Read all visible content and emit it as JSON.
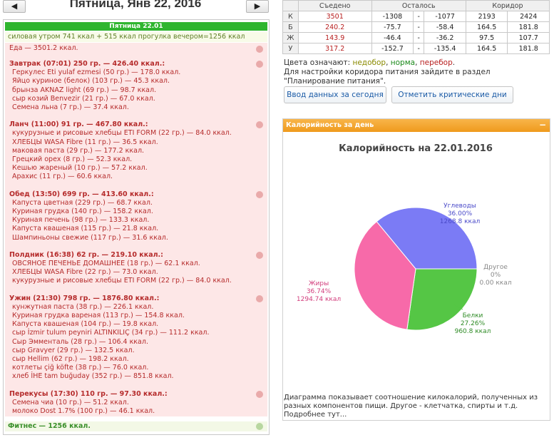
{
  "nav": {
    "prev_symbol": "◀",
    "next_symbol": "▶",
    "date_title": "Пятница, Янв 22, 2016"
  },
  "diary": {
    "day_bar": "Пятница 22.01",
    "activity": "силовая утром 741 ккал + 515 ккал прогулка вечером=1256 ккал",
    "food_total": "Еда — 3501.2 ккал.",
    "meals": [
      {
        "header": "Завтрак (07:01) 250 гр. — 426.40 ккал.:",
        "items": [
          "Геркулес Eti yulaf ezmesi (50 гр.) — 178.0 ккал.",
          "Яйцо куриное (белок) (103 гр.) — 45.3 ккал.",
          "брынза AKNAZ light (69 гр.) — 98.7 ккал.",
          "сыр козий Benvezir (21 гр.) — 67.0 ккал.",
          "Семена льна (7 гр.) — 37.4 ккал."
        ]
      },
      {
        "header": "Ланч (11:00) 91 гр. — 467.80 ккал.:",
        "items": [
          "кукурузные и рисовые хлебцы ETI FORM (22 гр.) — 84.0 ккал.",
          "ХЛЕБЦЫ WASA Fibre (11 гр.) — 36.5 ккал.",
          "маковая паста (29 гр.) — 177.2 ккал.",
          "Грецкий орех (8 гр.) — 52.3 ккал.",
          "Кешью жареный (10 гр.) — 57.2 ккал.",
          "Арахис (11 гр.) — 60.6 ккал."
        ]
      },
      {
        "header": "Обед (13:50) 699 гр. — 413.60 ккал.:",
        "items": [
          "Капуста цветная (229 гр.) — 68.7 ккал.",
          "Куриная грудка (140 гр.) — 158.2 ккал.",
          "Куриная печень (98 гр.) — 133.3 ккал.",
          "Капуста квашеная (115 гр.) — 21.8 ккал.",
          "Шампиньоны свежие (117 гр.) — 31.6 ккал."
        ]
      },
      {
        "header": "Полдник (16:38) 62 гр. — 219.10 ккал.:",
        "items": [
          "ОВСЯНОЕ ПЕЧЕНЬЕ ДОМАШНЕЕ (18 гр.) — 62.1 ккал.",
          "ХЛЕБЦЫ WASA Fibre (22 гр.) — 73.0 ккал.",
          "кукурузные и рисовые хлебцы ETI FORM (22 гр.) — 84.0 ккал."
        ]
      },
      {
        "header": "Ужин (21:30) 798 гр. — 1876.80 ккал.:",
        "items": [
          "кунжутная паста (38 гр.) — 226.1 ккал.",
          "Куриная грудка вареная (113 гр.) — 154.8 ккал.",
          "Капуста квашеная (104 гр.) — 19.8 ккал.",
          "сыр İzmir tulum peyniri ALTINKILIÇ (34 гр.) — 111.2 ккал.",
          "Сыр Эмменталь (28 гр.) — 106.4 ккал.",
          "сыр Gravyer (29 гр.) — 132.5 ккал.",
          "сыр Hellim (62 гр.) — 198.2 ккал.",
          "котлеты çiğ köfte (38 гр.) — 76.0 ккал.",
          "хлеб İHE tam buğuday (352 гр.) — 851.8 ккал."
        ]
      },
      {
        "header": "Перекусы (17:30) 110 гр. — 97.30 ккал.:",
        "items": [
          "Семена чиа (10 гр.) — 51.2 ккал.",
          "молоко Dost 1.7% (100 гр.) — 46.1 ккал."
        ]
      }
    ],
    "fitness": "Фитнес — 1256 ккал."
  },
  "stats": {
    "headers": [
      "Съедено",
      "Осталось",
      "Коридор"
    ],
    "rows": [
      {
        "label": "К",
        "eaten": "3501",
        "left_min": "-1308",
        "left_max": "-1077",
        "corr_min": "2193",
        "corr_max": "2424"
      },
      {
        "label": "Б",
        "eaten": "240.2",
        "left_min": "-75.7",
        "left_max": "-58.4",
        "corr_min": "164.5",
        "corr_max": "181.8"
      },
      {
        "label": "Ж",
        "eaten": "143.9",
        "left_min": "-46.4",
        "left_max": "-36.2",
        "corr_min": "97.5",
        "corr_max": "107.7"
      },
      {
        "label": "У",
        "eaten": "317.2",
        "left_min": "-152.7",
        "left_max": "-135.4",
        "corr_min": "164.5",
        "corr_max": "181.8"
      }
    ],
    "dash": "-"
  },
  "legend": {
    "prefix": "Цвета означают:",
    "under": "недобор",
    "norm": "норма",
    "over": "перебор",
    "sep": ",",
    "end": "."
  },
  "corridor_note": "Для настройки коридора питания зайдите в раздел \"Планирование питания\".",
  "buttons": {
    "enter_today": "Ввод данных за сегодня",
    "mark_critical": "Отметить критические дни"
  },
  "panel": {
    "title": "Калорийность за день",
    "toggle": "−"
  },
  "chart_data": {
    "type": "pie",
    "title": "Калорийность на 22.01.2016",
    "slices": [
      {
        "name": "Углеводы",
        "percent": 36.0,
        "percent_label": "36.00%",
        "value": 1268.8,
        "value_label": "1268.8 ккал",
        "color": "#7b7bf5"
      },
      {
        "name": "Другое",
        "percent": 0,
        "percent_label": "0%",
        "value": 0.0,
        "value_label": "0.00 ккал",
        "color": "#999999"
      },
      {
        "name": "Белки",
        "percent": 27.26,
        "percent_label": "27.26%",
        "value": 960.8,
        "value_label": "960.8 ккал",
        "color": "#55c645"
      },
      {
        "name": "Жиры",
        "percent": 36.74,
        "percent_label": "36.74%",
        "value": 1294.74,
        "value_label": "1294.74 ккал",
        "color": "#f76aa9"
      }
    ],
    "label_colors": {
      "Углеводы": "#4a4ac9",
      "Другое": "#888888",
      "Белки": "#2e8b25",
      "Жиры": "#d23d7c"
    }
  },
  "chart_caption": "Диаграмма показывает соотношение килокалорий, полученных из разных компонентов пищи. Другое - клетчатка, спирты и т.д. Подробнее тут..."
}
